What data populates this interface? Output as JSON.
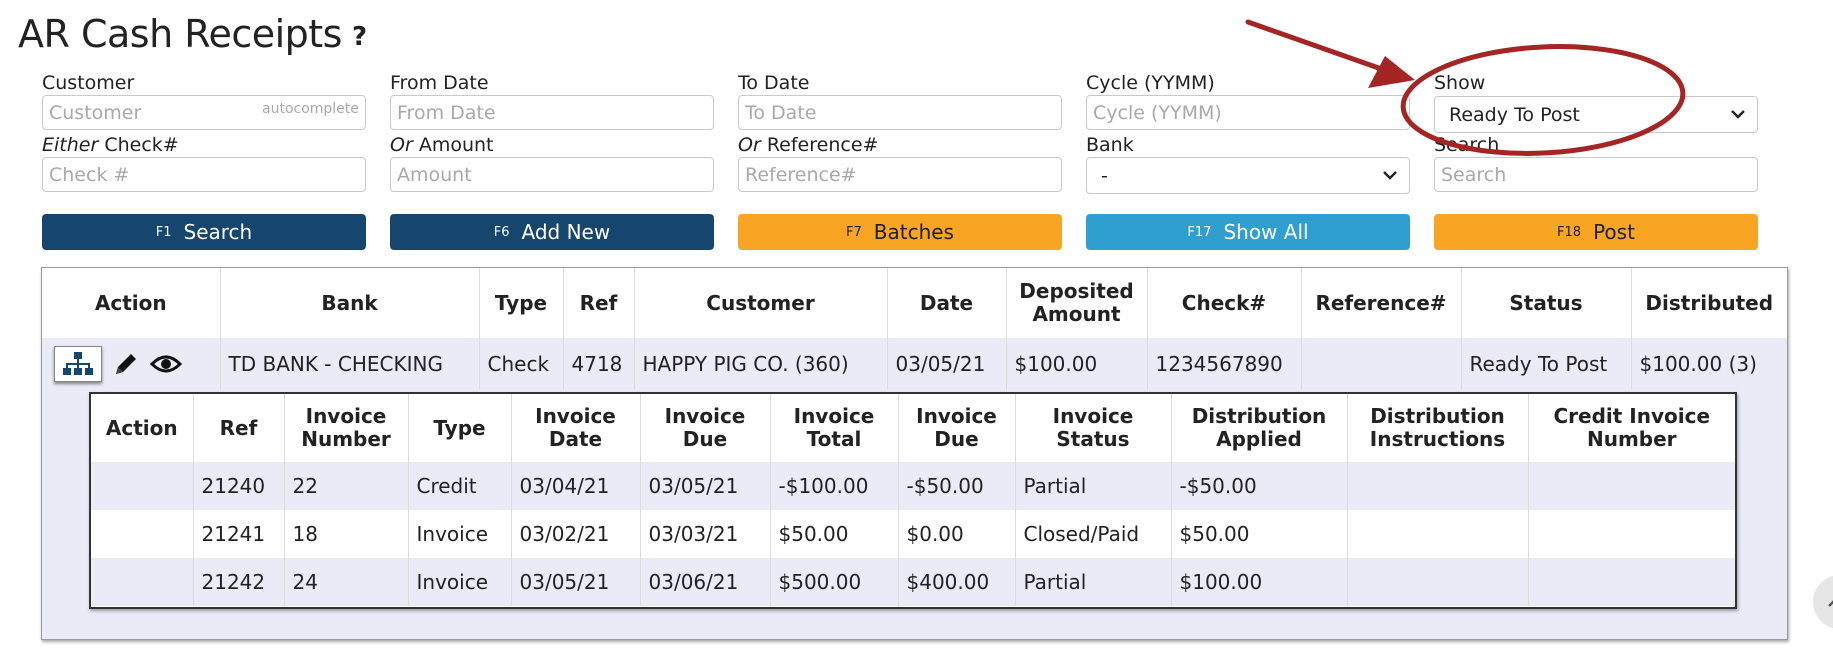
{
  "page": {
    "title": "AR Cash Receipts",
    "help": "?"
  },
  "filters": {
    "customer": {
      "label": "Customer",
      "placeholder": "Customer",
      "hint": "autocomplete"
    },
    "from_date": {
      "label": "From Date",
      "placeholder": "From Date"
    },
    "to_date": {
      "label": "To Date",
      "placeholder": "To Date"
    },
    "cycle": {
      "label": "Cycle (YYMM)",
      "placeholder": "Cycle (YYMM)"
    },
    "show": {
      "label": "Show",
      "value": "Ready To Post"
    },
    "check": {
      "label_prefix": "Either",
      "label": "Check#",
      "placeholder": "Check #"
    },
    "amount": {
      "label_prefix": "Or",
      "label": "Amount",
      "placeholder": "Amount"
    },
    "reference": {
      "label_prefix": "Or",
      "label": "Reference#",
      "placeholder": "Reference#"
    },
    "bank": {
      "label": "Bank",
      "value": "-"
    },
    "search": {
      "label": "Search",
      "placeholder": "Search"
    }
  },
  "buttons": [
    {
      "key": "F1",
      "label": "Search",
      "color": "#16466e"
    },
    {
      "key": "F6",
      "label": "Add New",
      "color": "#16466e"
    },
    {
      "key": "F7",
      "label": "Batches",
      "color": "#f7a523"
    },
    {
      "key": "F17",
      "label": "Show All",
      "color": "#2e9fcf"
    },
    {
      "key": "F18",
      "label": "Post",
      "color": "#f7a523"
    }
  ],
  "receipts": {
    "headers": [
      "Action",
      "Bank",
      "Type",
      "Ref",
      "Customer",
      "Date",
      "Deposited Amount",
      "Check#",
      "Reference#",
      "Status",
      "Distributed"
    ],
    "row": {
      "bank": "TD BANK - CHECKING",
      "type": "Check",
      "ref": "4718",
      "customer": "HAPPY PIG CO. (360)",
      "date": "03/05/21",
      "deposited_amount": "$100.00",
      "check": "1234567890",
      "reference": "",
      "status": "Ready To Post",
      "distributed": "$100.00 (3)"
    },
    "action_icons": [
      "org-chart-icon",
      "pencil-icon",
      "eye-icon"
    ]
  },
  "distributions": {
    "headers": [
      "Action",
      "Ref",
      "Invoice Number",
      "Type",
      "Invoice Date",
      "Invoice Due",
      "Invoice Total",
      "Invoice Due",
      "Invoice Status",
      "Distribution Applied",
      "Distribution Instructions",
      "Credit Invoice Number"
    ],
    "rows": [
      {
        "action": "",
        "ref": "21240",
        "invoice_number": "22",
        "type": "Credit",
        "invoice_date": "03/04/21",
        "invoice_due_date": "03/05/21",
        "invoice_total": "-$100.00",
        "invoice_due": "-$50.00",
        "status": "Partial",
        "applied": "-$50.00",
        "instructions": "",
        "credit_invoice": ""
      },
      {
        "action": "",
        "ref": "21241",
        "invoice_number": "18",
        "type": "Invoice",
        "invoice_date": "03/02/21",
        "invoice_due_date": "03/03/21",
        "invoice_total": "$50.00",
        "invoice_due": "$0.00",
        "status": "Closed/Paid",
        "applied": "$50.00",
        "instructions": "",
        "credit_invoice": ""
      },
      {
        "action": "",
        "ref": "21242",
        "invoice_number": "24",
        "type": "Invoice",
        "invoice_date": "03/05/21",
        "invoice_due_date": "03/06/21",
        "invoice_total": "$500.00",
        "invoice_due": "$400.00",
        "status": "Partial",
        "applied": "$100.00",
        "instructions": "",
        "credit_invoice": ""
      }
    ]
  },
  "annotation": {
    "color": "#a52424"
  }
}
